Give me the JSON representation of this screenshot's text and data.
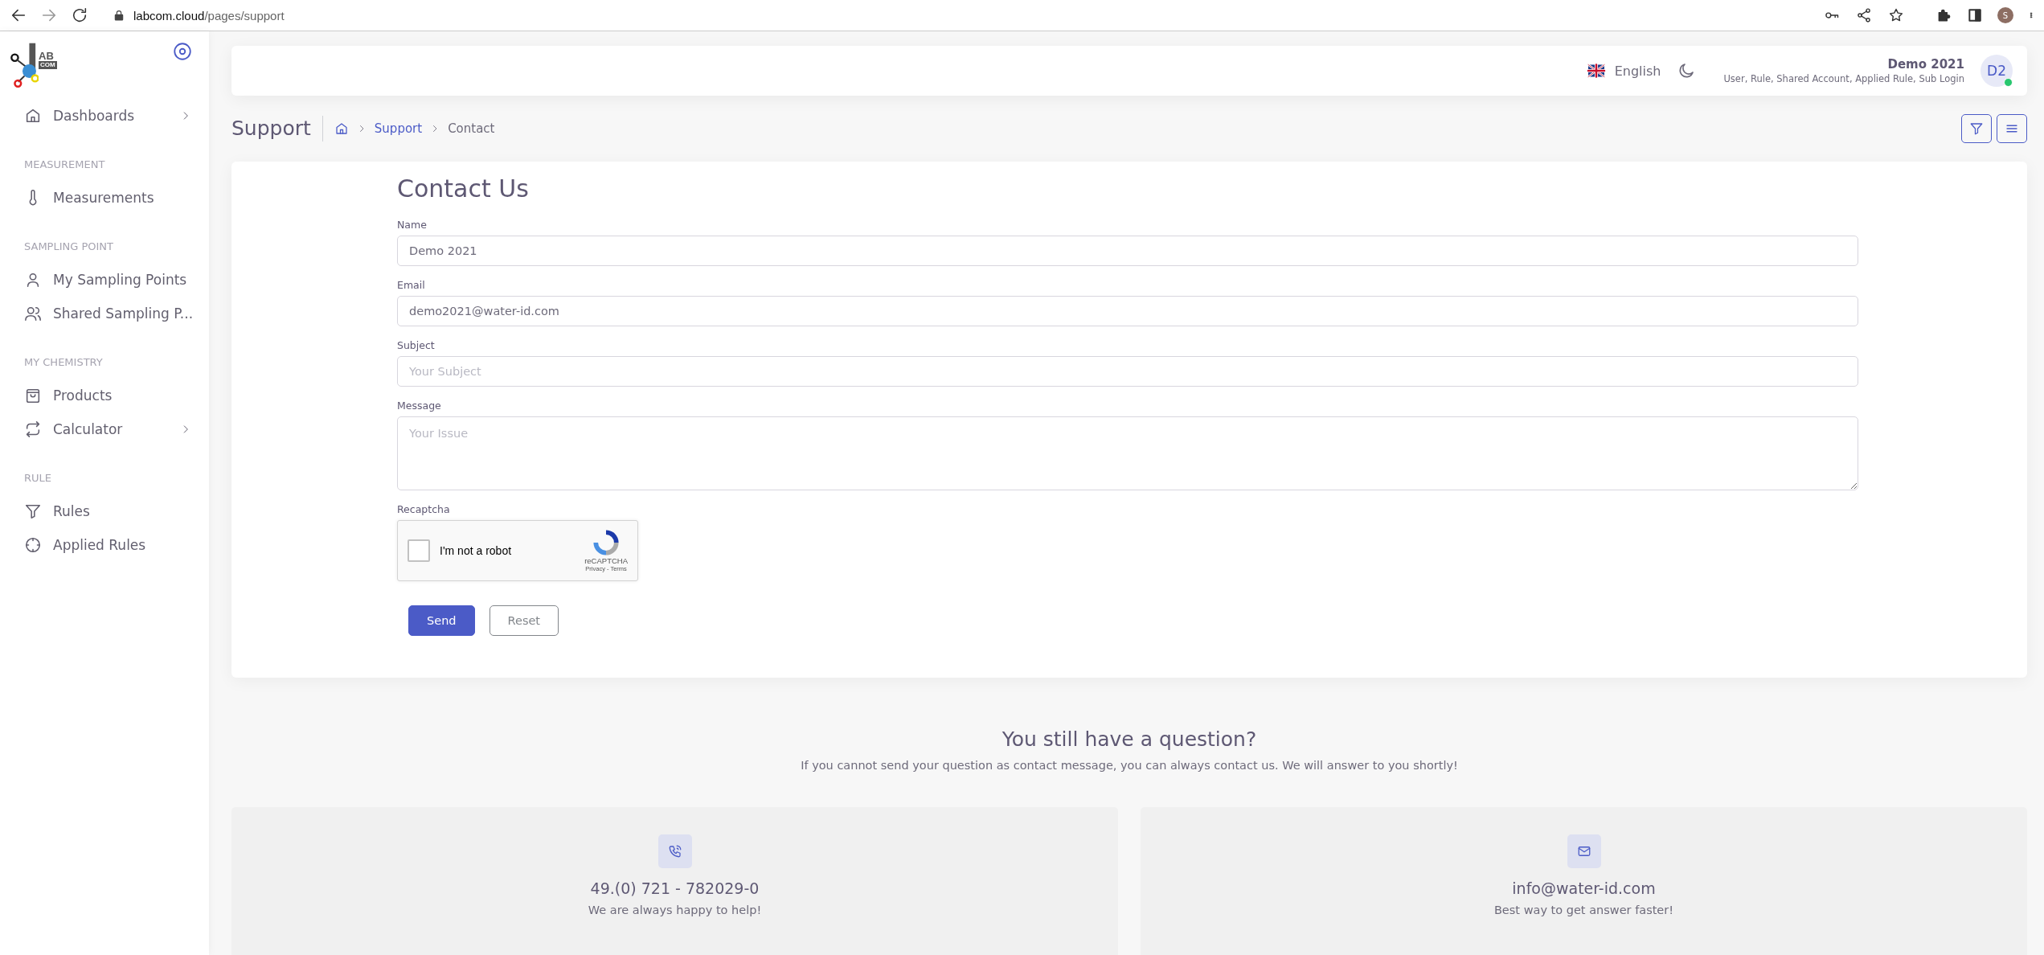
{
  "browser": {
    "url_host": "labcom.cloud",
    "url_path": "/pages/support",
    "profile_initial": "S"
  },
  "sidebar": {
    "logo": {
      "top": "AB",
      "bottom": "COM"
    },
    "sections": [
      {
        "items": [
          {
            "label": "Dashboards",
            "kind": "home",
            "submenu": true
          }
        ]
      },
      {
        "heading": "MEASUREMENT",
        "items": [
          {
            "label": "Measurements",
            "kind": "thermometer",
            "submenu": false
          }
        ]
      },
      {
        "heading": "SAMPLING POINT",
        "items": [
          {
            "label": "My Sampling Points",
            "kind": "user",
            "submenu": false
          },
          {
            "label": "Shared Sampling P...",
            "kind": "users",
            "submenu": false
          }
        ]
      },
      {
        "heading": "MY CHEMISTRY",
        "items": [
          {
            "label": "Products",
            "kind": "bag",
            "submenu": false
          },
          {
            "label": "Calculator",
            "kind": "repeat",
            "submenu": true
          }
        ]
      },
      {
        "heading": "RULE",
        "items": [
          {
            "label": "Rules",
            "kind": "filter",
            "submenu": false
          },
          {
            "label": "Applied Rules",
            "kind": "crosshair",
            "submenu": false
          }
        ]
      }
    ]
  },
  "header": {
    "language": "English",
    "user_name": "Demo 2021",
    "user_roles": "User, Rule, Shared Account, Applied Rule, Sub Login",
    "avatar_initials": "D2",
    "online": true
  },
  "page": {
    "title": "Support",
    "breadcrumb": [
      {
        "label": "Support",
        "link": true
      },
      {
        "label": "Contact",
        "link": false
      }
    ]
  },
  "form": {
    "title": "Contact Us",
    "fields": [
      {
        "label": "Name",
        "kind": "input",
        "value": "Demo 2021"
      },
      {
        "label": "Email",
        "kind": "input",
        "value": "demo2021@water-id.com"
      },
      {
        "label": "Subject",
        "kind": "input",
        "placeholder": "Your Subject"
      },
      {
        "label": "Message",
        "kind": "textarea",
        "placeholder": "Your Issue"
      }
    ],
    "captcha": {
      "label": "Recaptcha",
      "text": "I'm not a robot",
      "checked": false,
      "brand": "reCAPTCHA",
      "links": "Privacy - Terms"
    },
    "buttons": [
      {
        "label": "Send",
        "kind": "primary"
      },
      {
        "label": "Reset",
        "kind": "outline"
      }
    ]
  },
  "help": {
    "title": "You still have a question?",
    "text": "If you cannot send your question as contact message, you can always contact us. We will answer to you shortly!",
    "cards": [
      {
        "kind": "phone",
        "title": "49.(0) 721 - 782029-0",
        "text": "We are always happy to help!"
      },
      {
        "kind": "mail",
        "title": "info@water-id.com",
        "text": "Best way to get answer faster!"
      }
    ]
  }
}
